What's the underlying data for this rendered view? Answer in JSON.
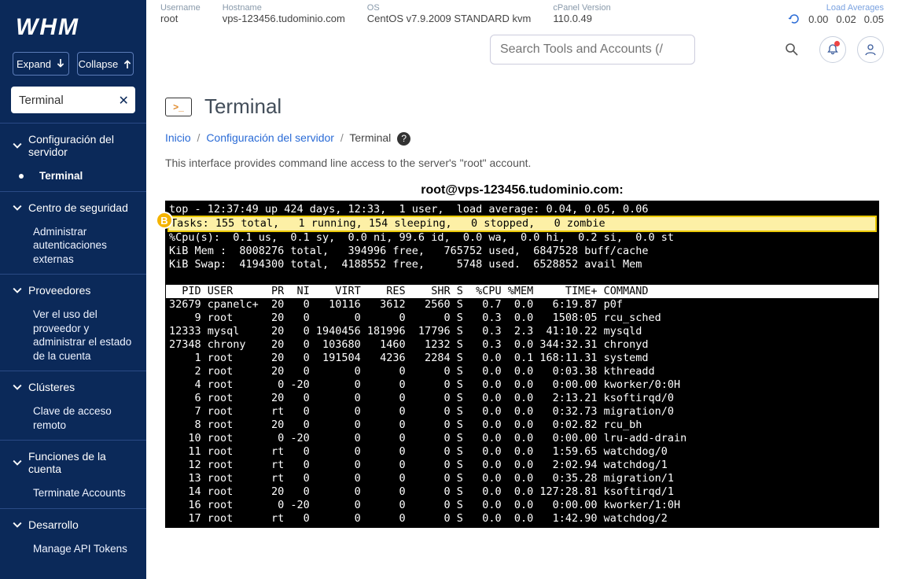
{
  "logo": "WHM",
  "sidebar": {
    "expand": "Expand",
    "collapse": "Collapse",
    "search_value": "Terminal",
    "groups": [
      {
        "title": "Configuración del servidor",
        "items": [
          {
            "label": "Terminal",
            "active": true,
            "bullet": true
          }
        ]
      },
      {
        "title": "Centro de seguridad",
        "items": [
          {
            "label": "Administrar autenticaciones externas"
          }
        ]
      },
      {
        "title": "Proveedores",
        "items": [
          {
            "label": "Ver el uso del proveedor y administrar el estado de la cuenta"
          }
        ]
      },
      {
        "title": "Clústeres",
        "items": [
          {
            "label": "Clave de acceso remoto"
          }
        ]
      },
      {
        "title": "Funciones de la cuenta",
        "items": [
          {
            "label": "Terminate Accounts"
          }
        ]
      },
      {
        "title": "Desarrollo",
        "items": [
          {
            "label": "Manage API Tokens"
          }
        ]
      }
    ]
  },
  "header": {
    "username_lbl": "Username",
    "username": "root",
    "hostname_lbl": "Hostname",
    "hostname": "vps-123456.tudominio.com",
    "os_lbl": "OS",
    "os": "CentOS v7.9.2009 STANDARD kvm",
    "cpver_lbl": "cPanel Version",
    "cpver": "110.0.49",
    "load_lbl": "Load Averages",
    "load1": "0.00",
    "load2": "0.02",
    "load3": "0.05",
    "search_placeholder": "Search Tools and Accounts (/)"
  },
  "page": {
    "title": "Terminal",
    "crumb_home": "Inicio",
    "crumb_mid": "Configuración del servidor",
    "crumb_leaf": "Terminal",
    "desc": "This interface provides command line access to the server's \"root\" account.",
    "term_host": "root@vps-123456.tudominio.com:"
  },
  "terminal": {
    "summary": {
      "top_line": "top - 12:37:49 up 424 days, 12:33,  1 user,  load average: 0.04, 0.05, 0.06",
      "tasks_line": "Tasks: 155 total,   1 running, 154 sleeping,   0 stopped,   0 zombie",
      "cpu_line": "%Cpu(s):  0.1 us,  0.1 sy,  0.0 ni, 99.6 id,  0.0 wa,  0.0 hi,  0.2 si,  0.0 st",
      "mem_line": "KiB Mem :  8008276 total,   394996 free,   765752 used,  6847528 buff/cache",
      "swap_line": "KiB Swap:  4194300 total,  4188552 free,     5748 used.  6528852 avail Mem"
    },
    "header_row": "  PID USER      PR  NI    VIRT    RES    SHR S  %CPU %MEM     TIME+ COMMAND",
    "rows": [
      {
        "pid": 32679,
        "user": "cpanelc+",
        "pr": "20",
        "ni": "0",
        "virt": "10116",
        "res": "3612",
        "shr": "2560",
        "s": "S",
        "cpu": "0.7",
        "mem": "0.0",
        "time": "6:19.87",
        "cmd": "p0f"
      },
      {
        "pid": 9,
        "user": "root",
        "pr": "20",
        "ni": "0",
        "virt": "0",
        "res": "0",
        "shr": "0",
        "s": "S",
        "cpu": "0.3",
        "mem": "0.0",
        "time": "1508:05",
        "cmd": "rcu_sched"
      },
      {
        "pid": 12333,
        "user": "mysql",
        "pr": "20",
        "ni": "0",
        "virt": "1940456",
        "res": "181996",
        "shr": "17796",
        "s": "S",
        "cpu": "0.3",
        "mem": "2.3",
        "time": "41:10.22",
        "cmd": "mysqld"
      },
      {
        "pid": 27348,
        "user": "chrony",
        "pr": "20",
        "ni": "0",
        "virt": "103680",
        "res": "1460",
        "shr": "1232",
        "s": "S",
        "cpu": "0.3",
        "mem": "0.0",
        "time": "344:32.31",
        "cmd": "chronyd"
      },
      {
        "pid": 1,
        "user": "root",
        "pr": "20",
        "ni": "0",
        "virt": "191504",
        "res": "4236",
        "shr": "2284",
        "s": "S",
        "cpu": "0.0",
        "mem": "0.1",
        "time": "168:11.31",
        "cmd": "systemd"
      },
      {
        "pid": 2,
        "user": "root",
        "pr": "20",
        "ni": "0",
        "virt": "0",
        "res": "0",
        "shr": "0",
        "s": "S",
        "cpu": "0.0",
        "mem": "0.0",
        "time": "0:03.38",
        "cmd": "kthreadd"
      },
      {
        "pid": 4,
        "user": "root",
        "pr": "0",
        "ni": "-20",
        "virt": "0",
        "res": "0",
        "shr": "0",
        "s": "S",
        "cpu": "0.0",
        "mem": "0.0",
        "time": "0:00.00",
        "cmd": "kworker/0:0H"
      },
      {
        "pid": 6,
        "user": "root",
        "pr": "20",
        "ni": "0",
        "virt": "0",
        "res": "0",
        "shr": "0",
        "s": "S",
        "cpu": "0.0",
        "mem": "0.0",
        "time": "2:13.21",
        "cmd": "ksoftirqd/0"
      },
      {
        "pid": 7,
        "user": "root",
        "pr": "rt",
        "ni": "0",
        "virt": "0",
        "res": "0",
        "shr": "0",
        "s": "S",
        "cpu": "0.0",
        "mem": "0.0",
        "time": "0:32.73",
        "cmd": "migration/0"
      },
      {
        "pid": 8,
        "user": "root",
        "pr": "20",
        "ni": "0",
        "virt": "0",
        "res": "0",
        "shr": "0",
        "s": "S",
        "cpu": "0.0",
        "mem": "0.0",
        "time": "0:02.82",
        "cmd": "rcu_bh"
      },
      {
        "pid": 10,
        "user": "root",
        "pr": "0",
        "ni": "-20",
        "virt": "0",
        "res": "0",
        "shr": "0",
        "s": "S",
        "cpu": "0.0",
        "mem": "0.0",
        "time": "0:00.00",
        "cmd": "lru-add-drain"
      },
      {
        "pid": 11,
        "user": "root",
        "pr": "rt",
        "ni": "0",
        "virt": "0",
        "res": "0",
        "shr": "0",
        "s": "S",
        "cpu": "0.0",
        "mem": "0.0",
        "time": "1:59.65",
        "cmd": "watchdog/0"
      },
      {
        "pid": 12,
        "user": "root",
        "pr": "rt",
        "ni": "0",
        "virt": "0",
        "res": "0",
        "shr": "0",
        "s": "S",
        "cpu": "0.0",
        "mem": "0.0",
        "time": "2:02.94",
        "cmd": "watchdog/1"
      },
      {
        "pid": 13,
        "user": "root",
        "pr": "rt",
        "ni": "0",
        "virt": "0",
        "res": "0",
        "shr": "0",
        "s": "S",
        "cpu": "0.0",
        "mem": "0.0",
        "time": "0:35.28",
        "cmd": "migration/1"
      },
      {
        "pid": 14,
        "user": "root",
        "pr": "20",
        "ni": "0",
        "virt": "0",
        "res": "0",
        "shr": "0",
        "s": "S",
        "cpu": "0.0",
        "mem": "0.0",
        "time": "127:28.81",
        "cmd": "ksoftirqd/1"
      },
      {
        "pid": 16,
        "user": "root",
        "pr": "0",
        "ni": "-20",
        "virt": "0",
        "res": "0",
        "shr": "0",
        "s": "S",
        "cpu": "0.0",
        "mem": "0.0",
        "time": "0:00.00",
        "cmd": "kworker/1:0H"
      },
      {
        "pid": 17,
        "user": "root",
        "pr": "rt",
        "ni": "0",
        "virt": "0",
        "res": "0",
        "shr": "0",
        "s": "S",
        "cpu": "0.0",
        "mem": "0.0",
        "time": "1:42.90",
        "cmd": "watchdog/2"
      }
    ]
  },
  "badge": "B"
}
